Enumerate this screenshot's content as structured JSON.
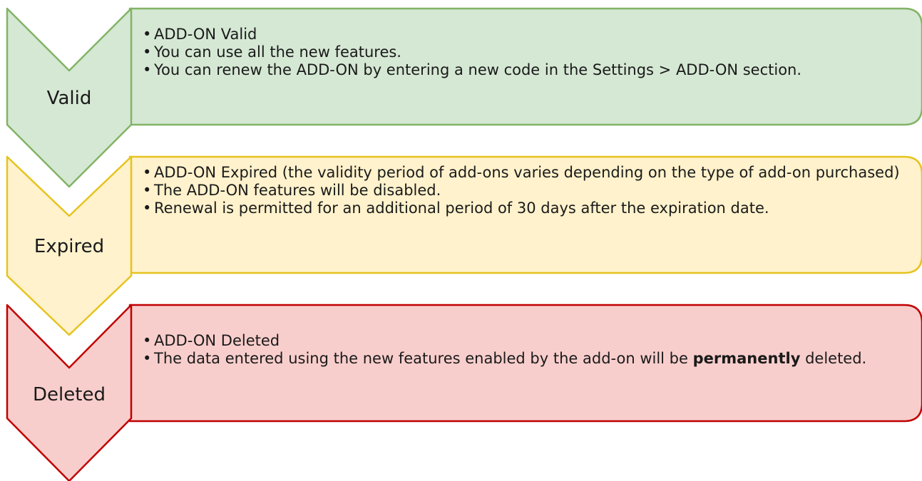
{
  "stages": [
    {
      "label": "Valid",
      "fill": "#d5e8d4",
      "stroke": "#82b366",
      "bullets": [
        "ADD-ON Valid",
        "You can use all the new features.",
        "You can renew the ADD-ON by entering a new code in the Settings > ADD-ON section."
      ]
    },
    {
      "label": "Expired",
      "fill": "#fff2cc",
      "stroke": "#e6c31e",
      "bullets": [
        "ADD-ON Expired (the validity period of add-ons varies depending on the type of add-on purchased)",
        "The ADD-ON features will be disabled.",
        "Renewal is permitted for an additional period of 30 days after the expiration date."
      ]
    },
    {
      "label": "Deleted",
      "fill": "#f8cecc",
      "stroke": "#c00000",
      "bullets": [
        "ADD-ON Deleted"
      ],
      "bullet_rich": {
        "before": "The data entered using the new features enabled by the add-on will be ",
        "bold": "permanently",
        "after": " deleted."
      }
    }
  ]
}
